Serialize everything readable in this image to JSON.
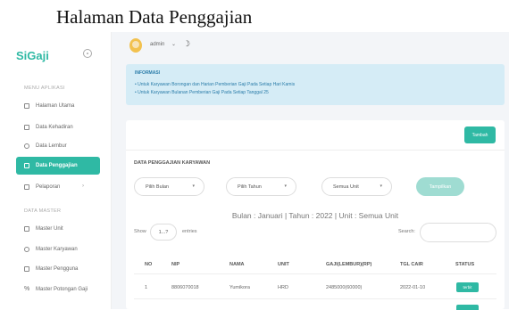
{
  "caption": "Halaman Data Penggajian",
  "app": {
    "logo": "SiGaji"
  },
  "sidebar": {
    "section_main": "MENU APLIKASI",
    "section_master": "DATA MASTER",
    "items": [
      {
        "label": "Halaman Utama",
        "icon": "home-icon"
      },
      {
        "label": "Data Kehadiran",
        "icon": "calendar-icon"
      },
      {
        "label": "Data Lembur",
        "icon": "clock-icon"
      },
      {
        "label": "Data Penggajian",
        "icon": "money-icon",
        "active": true
      },
      {
        "label": "Pelaporan",
        "icon": "report-icon"
      },
      {
        "label": "Master Unit",
        "icon": "building-icon"
      },
      {
        "label": "Master Karyawan",
        "icon": "users-icon"
      },
      {
        "label": "Master Pengguna",
        "icon": "user-lock-icon"
      },
      {
        "label": "Master Potongan Gaji",
        "icon": "percent-icon"
      }
    ]
  },
  "topbar": {
    "user": "admin"
  },
  "info": {
    "title": "INFORMASI",
    "items": [
      "Untuk Karyawan Borongan dan Harian Pemberian Gaji Pada Setiap Hari Kamis",
      "Untuk Karyawan Bulanan Pemberian Gaji Pada Setiap Tanggal 25"
    ]
  },
  "card": {
    "add_button": "Tambah",
    "title": "DATA PENGGAJIAN KARYAWAN",
    "filters": {
      "month": "Pilih Bulan",
      "year": "Pilih Tahun",
      "unit": "Semua Unit",
      "show_button": "Tampilkan"
    },
    "period_text": "Bulan : Januari | Tahun : 2022 | Unit : Semua Unit",
    "show_label": "Show",
    "entries_value": "1...?",
    "entries_label": "entries",
    "search_label": "Search:"
  },
  "table": {
    "columns": [
      "NO",
      "NIP",
      "NAMA",
      "UNIT",
      "GAJI(LEMBUR)(RP)",
      "TGL CAIR",
      "STATUS"
    ],
    "rows": [
      {
        "no": "1",
        "nip": "8806070018",
        "nama": "Yumikora",
        "unit": "HRD",
        "gaji": "2485000(60000)",
        "tgl": "2022-01-10",
        "status": "terbit"
      }
    ]
  },
  "colors": {
    "accent": "#2fb9a4",
    "info_bg": "#d5ecf6",
    "info_text": "#2a7ca9"
  }
}
